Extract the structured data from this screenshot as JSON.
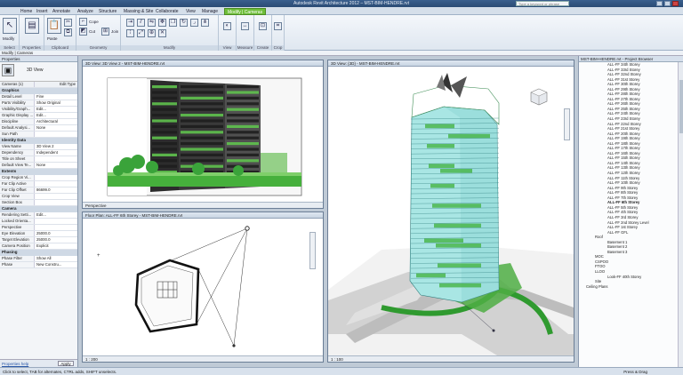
{
  "app": {
    "title": "Autodesk Revit Architecture 2012 – MST-BIM-HENDRE.rvt",
    "search_placeholder": "Type a keyword or phrase"
  },
  "tabs": [
    {
      "label": "Home"
    },
    {
      "label": "Insert"
    },
    {
      "label": "Annotate"
    },
    {
      "label": "Analyze"
    },
    {
      "label": "Structure"
    },
    {
      "label": "Massing & Site"
    },
    {
      "label": "Collaborate"
    },
    {
      "label": "View"
    },
    {
      "label": "Manage"
    },
    {
      "label": "Modify | Cameras"
    }
  ],
  "ribbon": {
    "groups": [
      "Select",
      "Properties",
      "Clipboard",
      "Geometry",
      "Modify",
      "View",
      "Measure",
      "Create",
      "Crop"
    ],
    "items": {
      "modify": "Modify",
      "cope": "Cope",
      "cut": "Cut",
      "join": "Join",
      "paste": "Paste"
    }
  },
  "modify_bar": "Modify | Cameras",
  "properties": {
    "header": "Properties",
    "type_name": "3D View",
    "type_selector": "Cameras (1)",
    "edit_type": "Edit Type",
    "sections": [
      {
        "title": "Graphics",
        "rows": [
          {
            "k": "Detail Level",
            "v": "Fine"
          },
          {
            "k": "Parts Visibility",
            "v": "Show Original"
          },
          {
            "k": "Visibility/Graph...",
            "v": "Edit..."
          },
          {
            "k": "Graphic Display ...",
            "v": "Edit..."
          },
          {
            "k": "Discipline",
            "v": "Architectural"
          },
          {
            "k": "Default Analysi...",
            "v": "None"
          },
          {
            "k": "Sun Path",
            "v": ""
          }
        ]
      },
      {
        "title": "Identity Data",
        "rows": [
          {
            "k": "View Name",
            "v": "3D View 2"
          },
          {
            "k": "Dependency",
            "v": "Independent"
          },
          {
            "k": "Title on Sheet",
            "v": ""
          },
          {
            "k": "Default View Te...",
            "v": "None"
          }
        ]
      },
      {
        "title": "Extents",
        "rows": [
          {
            "k": "Crop Region Vi...",
            "v": ""
          },
          {
            "k": "Far Clip Active",
            "v": ""
          },
          {
            "k": "Far Clip Offset",
            "v": "86699.0"
          },
          {
            "k": "Crop View",
            "v": ""
          },
          {
            "k": "Section Box",
            "v": ""
          }
        ]
      },
      {
        "title": "Camera",
        "rows": [
          {
            "k": "Rendering Setti...",
            "v": "Edit..."
          },
          {
            "k": "Locked Orienta...",
            "v": ""
          },
          {
            "k": "Perspective",
            "v": ""
          },
          {
            "k": "Eye Elevation",
            "v": "25000.0"
          },
          {
            "k": "Target Elevation",
            "v": "25000.0"
          },
          {
            "k": "Camera Position",
            "v": "Explicit"
          }
        ]
      },
      {
        "title": "Phasing",
        "rows": [
          {
            "k": "Phase Filter",
            "v": "Show All"
          },
          {
            "k": "Phase",
            "v": "New Constru..."
          }
        ]
      }
    ],
    "help_link": "Properties help",
    "apply": "Apply"
  },
  "views": {
    "top_left": {
      "title": "3D View: 3D View 2 - MST-BIM-HENDRE.rvt",
      "footer": "Perspective"
    },
    "bottom_left": {
      "title": "Floor Plan: ALL-FF 6th Storey - MST-BIM-HENDRE.rvt",
      "footer": "1 : 200"
    },
    "right": {
      "title": "3D View: {3D} - MST-BIM-HENDRE.rvt",
      "footer": "1 : 100"
    }
  },
  "browser": {
    "header": "MST-BIM-HENDRE.rvt - Project Browser",
    "items": [
      {
        "label": "ALL-FF 34th Storey",
        "lvl": 2
      },
      {
        "label": "ALL-FF 33rd Storey",
        "lvl": 2
      },
      {
        "label": "ALL-FF 32nd Storey",
        "lvl": 2
      },
      {
        "label": "ALL-FF 31st Storey",
        "lvl": 2
      },
      {
        "label": "ALL-FF 30th Storey",
        "lvl": 2
      },
      {
        "label": "ALL-FF 29th Storey",
        "lvl": 2
      },
      {
        "label": "ALL-FF 28th Storey",
        "lvl": 2
      },
      {
        "label": "ALL-FF 27th Storey",
        "lvl": 2
      },
      {
        "label": "ALL-FF 26th Storey",
        "lvl": 2
      },
      {
        "label": "ALL-FF 25th Storey",
        "lvl": 2
      },
      {
        "label": "ALL-FF 24th Storey",
        "lvl": 2
      },
      {
        "label": "ALL-FF 23rd Storey",
        "lvl": 2
      },
      {
        "label": "ALL-FF 22nd Storey",
        "lvl": 2
      },
      {
        "label": "ALL-FF 21st Storey",
        "lvl": 2
      },
      {
        "label": "ALL-FF 20th Storey",
        "lvl": 2
      },
      {
        "label": "ALL-FF 19th Storey",
        "lvl": 2
      },
      {
        "label": "ALL-FF 18th Storey",
        "lvl": 2
      },
      {
        "label": "ALL-FF 17th Storey",
        "lvl": 2
      },
      {
        "label": "ALL-FF 16th Storey",
        "lvl": 2
      },
      {
        "label": "ALL-FF 15th Storey",
        "lvl": 2
      },
      {
        "label": "ALL-FF 14th Storey",
        "lvl": 2
      },
      {
        "label": "ALL-FF 13th Storey",
        "lvl": 2
      },
      {
        "label": "ALL-FF 12th Storey",
        "lvl": 2
      },
      {
        "label": "ALL-FF 11th Storey",
        "lvl": 2
      },
      {
        "label": "ALL-FF 10th Storey",
        "lvl": 2
      },
      {
        "label": "ALL-FF 9th Storey",
        "lvl": 2
      },
      {
        "label": "ALL-FF 8th Storey",
        "lvl": 2
      },
      {
        "label": "ALL-FF 7th Storey",
        "lvl": 2
      },
      {
        "label": "ALL-FF 6th Storey",
        "lvl": 2,
        "sel": true
      },
      {
        "label": "ALL-FF 5th Storey",
        "lvl": 2
      },
      {
        "label": "ALL-FF 4th Storey",
        "lvl": 2
      },
      {
        "label": "ALL-FF 3rd Storey",
        "lvl": 2
      },
      {
        "label": "ALL-FF 2nd Storey Level",
        "lvl": 2
      },
      {
        "label": "ALL-FF 1st Storey",
        "lvl": 2
      },
      {
        "label": "ALL-FF GFL",
        "lvl": 2
      },
      {
        "label": "Roof",
        "lvl": 1
      },
      {
        "label": "Basement 1",
        "lvl": 2
      },
      {
        "label": "Basement 2",
        "lvl": 2
      },
      {
        "label": "Basement 3",
        "lvl": 2
      },
      {
        "label": "MOC",
        "lvl": 1
      },
      {
        "label": "CSPOO",
        "lvl": 1
      },
      {
        "label": "FTOO",
        "lvl": 1
      },
      {
        "label": "LLOO",
        "lvl": 1
      },
      {
        "label": "Look-FF 40th Storey",
        "lvl": 2
      },
      {
        "label": "Site",
        "lvl": 1
      },
      {
        "label": "Ceiling Plans",
        "lvl": 0
      }
    ]
  },
  "status": {
    "message": "Click to select, TAB for alternates, CTRL adds, SHIFT unselects.",
    "right": "Press & Drag"
  },
  "colors": {
    "accent": "#6fbe3a",
    "glass": "#a9e6e4",
    "green": "#3fb03a"
  }
}
